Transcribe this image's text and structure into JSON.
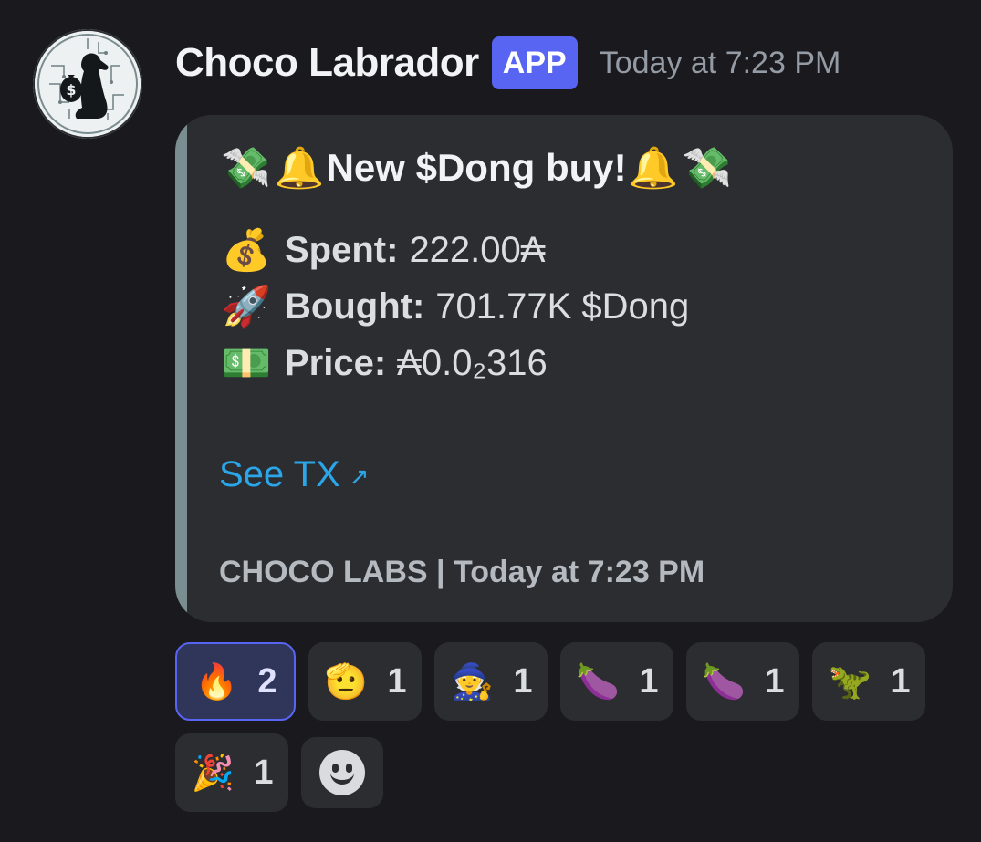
{
  "author": {
    "name": "Choco Labrador",
    "badge": "APP",
    "timestamp": "Today at 7:23 PM",
    "avatar_icon": "dog-with-money-bag-icon"
  },
  "embed": {
    "accent_color": "#7a8e91",
    "title": {
      "prefix_emojis": [
        "💸",
        "🔔"
      ],
      "text": "New $Dong buy!",
      "suffix_emojis": [
        "🔔",
        "💸"
      ]
    },
    "fields": [
      {
        "icon": "💰",
        "label": "Spent:",
        "value": "222.00₳"
      },
      {
        "icon": "🚀",
        "label": "Bought:",
        "value": "701.77K $Dong"
      },
      {
        "icon": "💵",
        "label": "Price:",
        "value": "₳0.0₂316"
      }
    ],
    "link": {
      "text": "See TX",
      "arrow": "↗"
    },
    "footer": "CHOCO LABS | Today at 7:23 PM"
  },
  "reactions": [
    {
      "emoji": "🔥",
      "count": "2",
      "active": true,
      "icon_name": "fire-icon"
    },
    {
      "emoji": "🫡",
      "count": "1",
      "active": false,
      "icon_name": "saluting-face-icon"
    },
    {
      "emoji": "🧙",
      "count": "1",
      "active": false,
      "icon_name": "wizard-icon"
    },
    {
      "emoji": "🍆",
      "count": "1",
      "active": false,
      "icon_name": "eggplant-character-icon"
    },
    {
      "emoji": "🍆",
      "count": "1",
      "active": false,
      "icon_name": "eggplant-flashlight-icon"
    },
    {
      "emoji": "🦖",
      "count": "1",
      "active": false,
      "icon_name": "dino-custom-emoji-icon"
    },
    {
      "emoji": "🎉",
      "count": "1",
      "active": false,
      "icon_name": "party-popper-icon"
    }
  ],
  "add_reaction_icon": "add-reaction-smiley-icon"
}
